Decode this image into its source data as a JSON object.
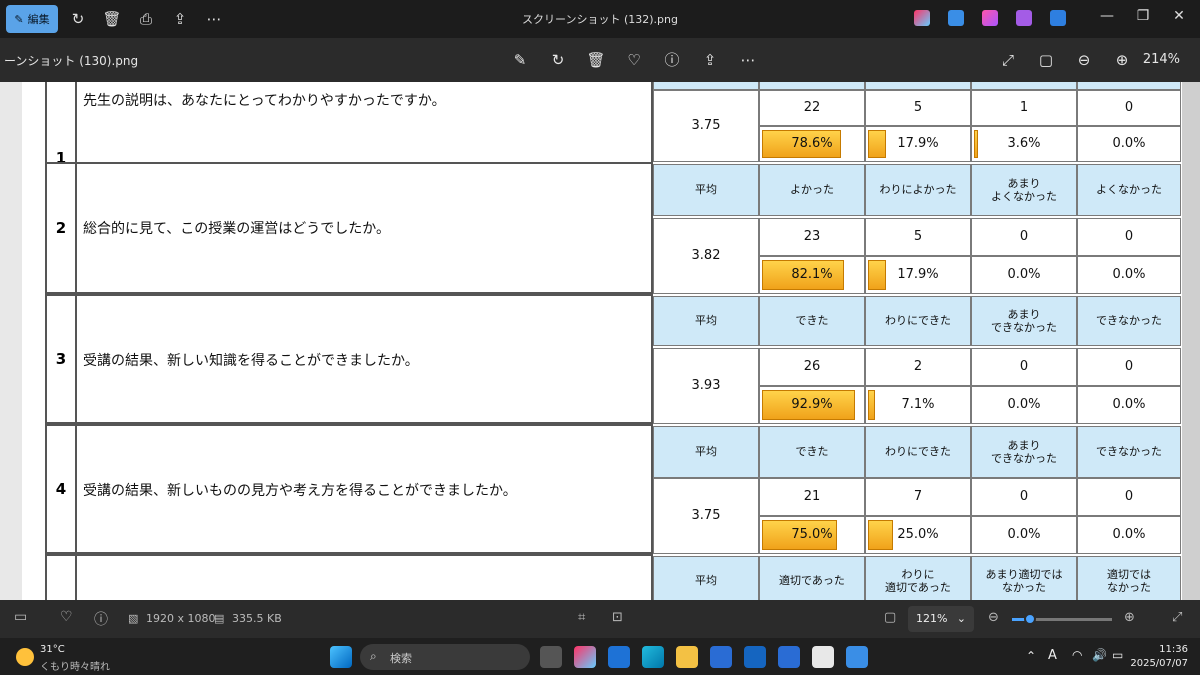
{
  "app": {
    "edit_label": "編集",
    "window_title": "スクリーンショット (132).png",
    "inner_title": "ーンショット (130).png",
    "inner_zoom": "214%"
  },
  "survey": {
    "questions": [
      {
        "num": "1",
        "text": "先生の説明は、あなたにとってわかりやすかったですか。",
        "header": null,
        "avg": "3.75",
        "counts": [
          "22",
          "5",
          "1",
          "0"
        ],
        "percents": [
          "78.6%",
          "17.9%",
          "3.6%",
          "0.0%"
        ],
        "fill": [
          0.786,
          0.179,
          0.036,
          0.0
        ]
      },
      {
        "num": "2",
        "text": "総合的に見て、この授業の運営はどうでしたか。",
        "header": [
          "平均",
          "よかった",
          "わりによかった",
          "あまり\nよくなかった",
          "よくなかった"
        ],
        "avg": "3.82",
        "counts": [
          "23",
          "5",
          "0",
          "0"
        ],
        "percents": [
          "82.1%",
          "17.9%",
          "0.0%",
          "0.0%"
        ],
        "fill": [
          0.821,
          0.179,
          0.0,
          0.0
        ]
      },
      {
        "num": "3",
        "text": "受講の結果、新しい知識を得ることができましたか。",
        "header": [
          "平均",
          "できた",
          "わりにできた",
          "あまり\nできなかった",
          "できなかった"
        ],
        "avg": "3.93",
        "counts": [
          "26",
          "2",
          "0",
          "0"
        ],
        "percents": [
          "92.9%",
          "7.1%",
          "0.0%",
          "0.0%"
        ],
        "fill": [
          0.929,
          0.071,
          0.0,
          0.0
        ]
      },
      {
        "num": "4",
        "text": "受講の結果、新しいものの見方や考え方を得ることができましたか。",
        "header": [
          "平均",
          "できた",
          "わりにできた",
          "あまり\nできなかった",
          "できなかった"
        ],
        "avg": "3.75",
        "counts": [
          "21",
          "7",
          "0",
          "0"
        ],
        "percents": [
          "75.0%",
          "25.0%",
          "0.0%",
          "0.0%"
        ],
        "fill": [
          0.75,
          0.25,
          0.0,
          0.0
        ]
      },
      {
        "num": "",
        "text": "",
        "header": [
          "平均",
          "適切であった",
          "わりに\n適切であった",
          "あまり適切では\nなかった",
          "適切では\nなかった"
        ],
        "avg": null
      }
    ]
  },
  "status": {
    "dimensions": "1920 x 1080",
    "filesize": "335.5 KB",
    "zoom": "121%",
    "zoom_level": 0.18
  },
  "taskbar": {
    "temp": "31°C",
    "weather": "くもり時々晴れ",
    "search_placeholder": "検索",
    "time": "11:36",
    "date": "2025/07/07",
    "ime": "A"
  }
}
